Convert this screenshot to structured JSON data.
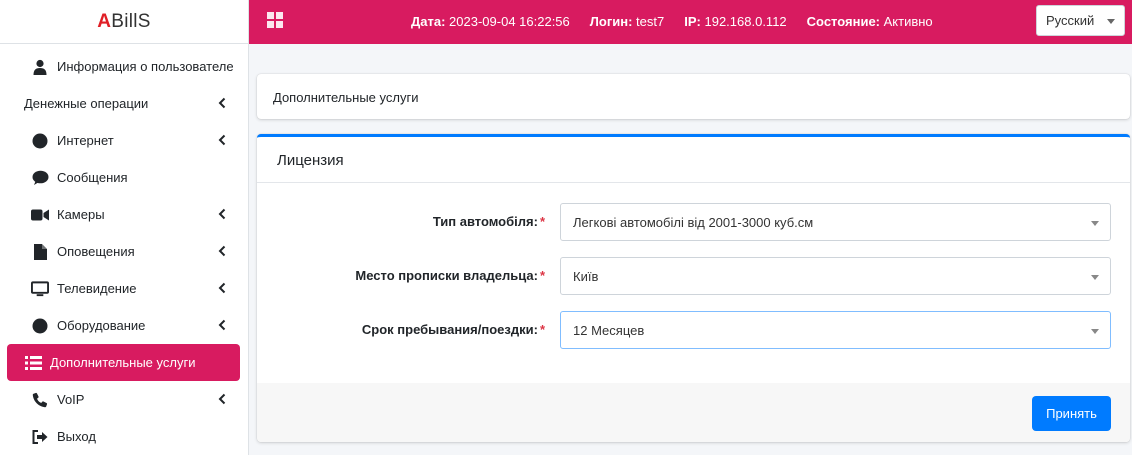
{
  "brand": {
    "accent": "A",
    "rest": "BillS"
  },
  "topbar": {
    "date_label": "Дата:",
    "date_value": "2023-09-04 16:22:56",
    "login_label": "Логин:",
    "login_value": "test7",
    "ip_label": "IP:",
    "ip_value": "192.168.0.112",
    "state_label": "Состояние:",
    "state_value": "Активно",
    "language": "Русский"
  },
  "sidebar": {
    "items": [
      {
        "label": "Информация о пользователе",
        "icon": "user-icon",
        "chevron": false,
        "active": false
      },
      {
        "label": "Денежные операции",
        "icon": "",
        "chevron": true,
        "active": false
      },
      {
        "label": "Интернет",
        "icon": "circle-icon",
        "chevron": true,
        "active": false
      },
      {
        "label": "Сообщения",
        "icon": "comment-icon",
        "chevron": false,
        "active": false
      },
      {
        "label": "Камеры",
        "icon": "video-icon",
        "chevron": true,
        "active": false
      },
      {
        "label": "Оповещения",
        "icon": "file-icon",
        "chevron": true,
        "active": false
      },
      {
        "label": "Телевидение",
        "icon": "tv-icon",
        "chevron": true,
        "active": false
      },
      {
        "label": "Оборудование",
        "icon": "circle-icon",
        "chevron": true,
        "active": false
      },
      {
        "label": "Дополнительные услуги",
        "icon": "list-icon",
        "chevron": false,
        "active": true
      },
      {
        "label": "VoIP",
        "icon": "phone-icon",
        "chevron": true,
        "active": false
      },
      {
        "label": "Выход",
        "icon": "sign-out-icon",
        "chevron": false,
        "active": false
      }
    ]
  },
  "main": {
    "section_title": "Дополнительные услуги",
    "license": {
      "title": "Лицензия",
      "fields": [
        {
          "label": "Тип автомобіля:",
          "required": "*",
          "value": "Легкові автомобілі від 2001-3000 куб.см"
        },
        {
          "label": "Место прописки владельца:",
          "required": "*",
          "value": "Київ"
        },
        {
          "label": "Срок пребывания/поездки:",
          "required": "*",
          "value": "12 Месяцев"
        }
      ],
      "submit_label": "Принять"
    }
  },
  "colors": {
    "accent": "#d81b60",
    "primary": "#007bff",
    "required": "#dc3545",
    "brand_accent": "#e01f26"
  }
}
